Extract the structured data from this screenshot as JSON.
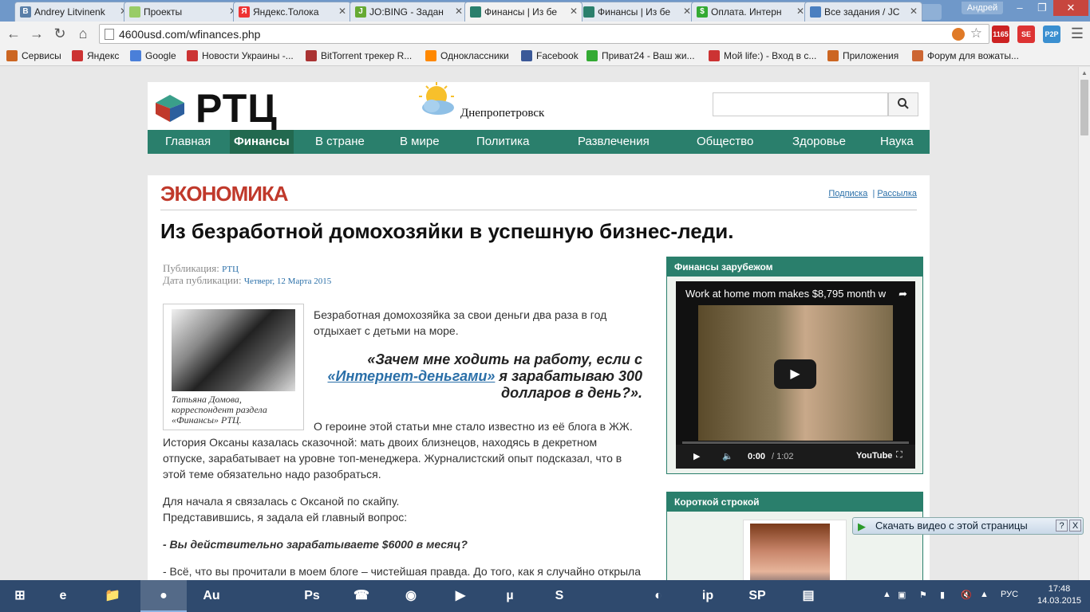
{
  "browser": {
    "tabs": [
      {
        "label": "Andrey Litvinenk",
        "fav": "В",
        "fav_color": "#5a7fa8",
        "active": false
      },
      {
        "label": "Проекты",
        "fav": "",
        "fav_color": "#9c6",
        "active": false
      },
      {
        "label": "Яндекс.Толока",
        "fav": "Я",
        "fav_color": "#e33",
        "active": false
      },
      {
        "label": "JO:BING - Задан",
        "fav": "J",
        "fav_color": "#6a3",
        "active": false
      },
      {
        "label": "Финансы | Из бе",
        "fav": "",
        "fav_color": "#2a7f6c",
        "active": true
      },
      {
        "label": "Финансы | Из бе",
        "fav": "",
        "fav_color": "#2a7f6c",
        "active": false
      },
      {
        "label": "Оплата. Интерн",
        "fav": "$",
        "fav_color": "#3a3",
        "active": false
      },
      {
        "label": "Все задания / JC",
        "fav": "",
        "fav_color": "#4a7fc0",
        "active": false
      }
    ],
    "user": "Андрей",
    "url": "4600usd.com/wfinances.php",
    "mail_count": "1165",
    "bookmarks": [
      {
        "label": "Сервисы",
        "color": "#c62"
      },
      {
        "label": "Яндекс",
        "color": "#c33"
      },
      {
        "label": "Google",
        "color": "#4a7fd9"
      },
      {
        "label": "Новости Украины -...",
        "color": "#c33"
      },
      {
        "label": "BitTorrent трекер R...",
        "color": "#a33"
      },
      {
        "label": "Одноклассники",
        "color": "#f80"
      },
      {
        "label": "Facebook",
        "color": "#3b5998"
      },
      {
        "label": "Приват24 - Ваш жи...",
        "color": "#3a3"
      },
      {
        "label": "Мой life:) - Вход в с...",
        "color": "#c33"
      },
      {
        "label": "Приложения",
        "color": "#c62"
      },
      {
        "label": "Форум для вожаты...",
        "color": "#c63"
      }
    ]
  },
  "site": {
    "logo": "РТЦ",
    "city": "Днепропетровск",
    "nav": [
      "Главная",
      "Финансы",
      "В стране",
      "В мире",
      "Политика",
      "Развлечения",
      "Общество",
      "Здоровье",
      "Наука"
    ],
    "nav_current": "Финансы"
  },
  "article": {
    "section": "ЭКОНОМИКА",
    "subscribe": "Подписка",
    "separator": "|",
    "mailing": "Рассылка",
    "title": "Из безработной домохозяйки в успешную бизнес-леди.",
    "pub_label": "Публикация:",
    "pub_value": "РТЦ",
    "date_label": "Дата публикации:",
    "date_value": "Четверг, 12 Марта 2015",
    "caption": "Татьяна Домова, корреспондент раздела «Финансы» РТЦ.",
    "p1": "Безработная домохозяйка за свои деньги два раза в год отдыхает с детьми на море.",
    "quote_a": "«Зачем мне ходить на работу, если с",
    "quote_link": "«Интернет-деньгами»",
    "quote_b": "я зарабатываю 300 долларов в день?».",
    "p2": "О героине этой статьи мне стало известно из её блога в ЖЖ. История Оксаны казалась сказочной: мать двоих близнецов, находясь в декретном отпуске, зарабатывает на уровне топ-менеджера. Журналистский опыт подсказал, что в этой теме обязательно надо разобраться.",
    "p3a": "Для начала я связалась с Оксаной по скайпу.",
    "p3b": "Представившись, я задала ей главный вопрос:",
    "q": "- Вы действительно зарабатываете $6000 в месяц?",
    "p4": "- Всё, что вы прочитали в моем блоге – чистейшая правда. До того, как я случайно открыла для себя «Интернет-деньги», я была несчастной домохозяйкой, которая считала дни до очередной зарплаты мужа, которой едва хватало только на детей."
  },
  "sidebar": {
    "box1_title": "Финансы зарубежом",
    "video_title": "Work at home mom makes $8,795 month w",
    "video_time": "0:00",
    "video_duration": "/ 1:02",
    "video_brand": "YouTube",
    "box2_title": "Короткой строкой"
  },
  "download_bar": {
    "label": "Скачать видео с этой страницы",
    "help": "?",
    "close": "X"
  },
  "taskbar": {
    "apps": [
      "IE",
      "Explorer",
      "Chrome",
      "Au",
      "Ps",
      "Viber",
      "Media",
      "VS",
      "uTorrent",
      "Skype",
      "Firefox",
      "ip",
      "SP",
      "Notes"
    ],
    "lang": "РУС",
    "time": "17:48",
    "date": "14.03.2015"
  }
}
